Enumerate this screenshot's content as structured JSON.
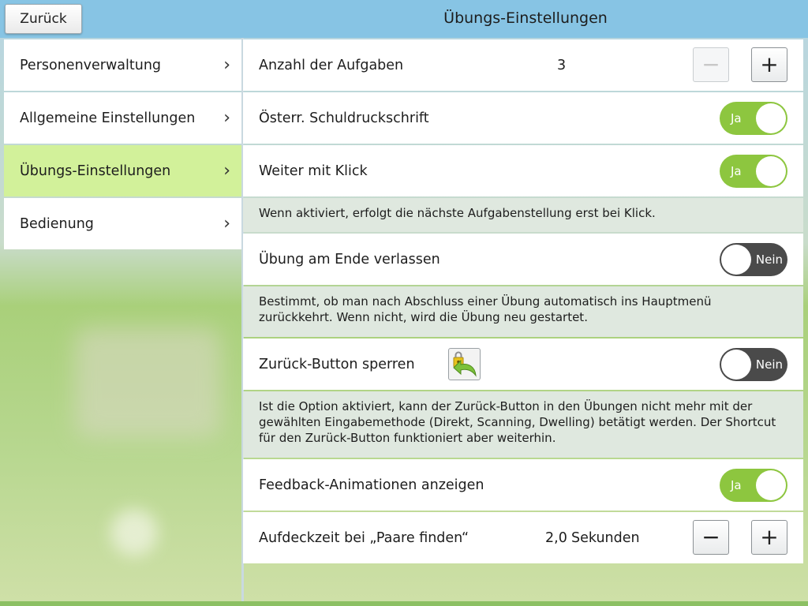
{
  "header": {
    "back_label": "Zurück",
    "title": "Übungs-Einstellungen"
  },
  "sidebar": {
    "items": [
      {
        "label": "Personenverwaltung",
        "active": false
      },
      {
        "label": "Allgemeine Einstellungen",
        "active": false
      },
      {
        "label": "Übungs-Einstellungen",
        "active": true
      },
      {
        "label": "Bedienung",
        "active": false
      }
    ],
    "chevron": "›"
  },
  "settings": {
    "tasks": {
      "label": "Anzahl der Aufgaben",
      "value": "3",
      "minus": "−",
      "plus": "+"
    },
    "handwriting": {
      "label": "Österr. Schuldruckschrift",
      "toggle": "Ja"
    },
    "next_click": {
      "label": "Weiter mit Klick",
      "toggle": "Ja",
      "description": "Wenn aktiviert, erfolgt die nächste Aufgabenstellung erst bei Klick."
    },
    "exit_end": {
      "label": "Übung am Ende verlassen",
      "toggle": "Nein",
      "description": "Bestimmt, ob man nach Abschluss einer Übung automatisch ins Hauptmenü zurückkehrt. Wenn nicht, wird die Übung neu gestartet."
    },
    "lock_back": {
      "label": "Zurück-Button sperren",
      "toggle": "Nein",
      "description": "Ist die Option aktiviert, kann der Zurück-Button in den Übungen nicht mehr mit der gewählten Eingabemethode (Direkt, Scanning, Dwelling) betätigt werden. Der Shortcut für den Zurück-Button funktioniert aber weiterhin."
    },
    "feedback": {
      "label": "Feedback-Animationen anzeigen",
      "toggle": "Ja"
    },
    "reveal_time": {
      "label": "Aufdeckzeit bei „Paare finden“",
      "value": "2,0",
      "unit": "Sekunden",
      "minus": "−",
      "plus": "+"
    }
  },
  "colors": {
    "header_bg": "#87c4e4",
    "active_item": "#d2f19a",
    "toggle_on": "#8dc63f",
    "toggle_off": "#4a4a4a",
    "description_bg": "#dfe8df"
  },
  "icons": {
    "lock_back": "lock-back-arrow-icon"
  }
}
